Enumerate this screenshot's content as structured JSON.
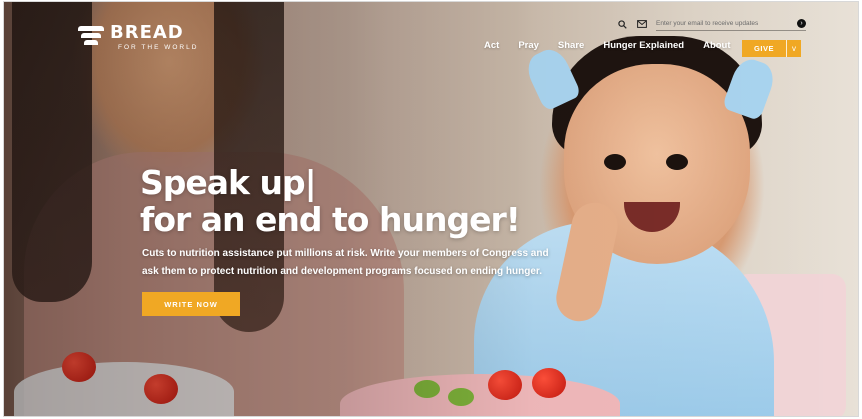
{
  "brand": {
    "name": "BREAD",
    "tagline": "FOR THE WORLD"
  },
  "utility": {
    "search_icon": "search-icon",
    "mail_icon": "mail-icon",
    "email_placeholder": "Enter your email to receive updates",
    "submit_icon": "arrow-right-icon"
  },
  "nav": {
    "items": [
      "Act",
      "Pray",
      "Share",
      "Hunger Explained",
      "About"
    ],
    "give_label": "GIVE",
    "give_dropdown_glyph": "v"
  },
  "hero": {
    "headline_line1": "Speak up|",
    "headline_line2": "for an end to hunger!",
    "body": "Cuts to nutrition assistance put millions at risk. Write your members of Congress and ask them to protect nutrition and development programs focused on ending hunger.",
    "cta_label": "WRITE NOW"
  },
  "colors": {
    "accent": "#f0a824",
    "text_on_photo": "#ffffff"
  }
}
